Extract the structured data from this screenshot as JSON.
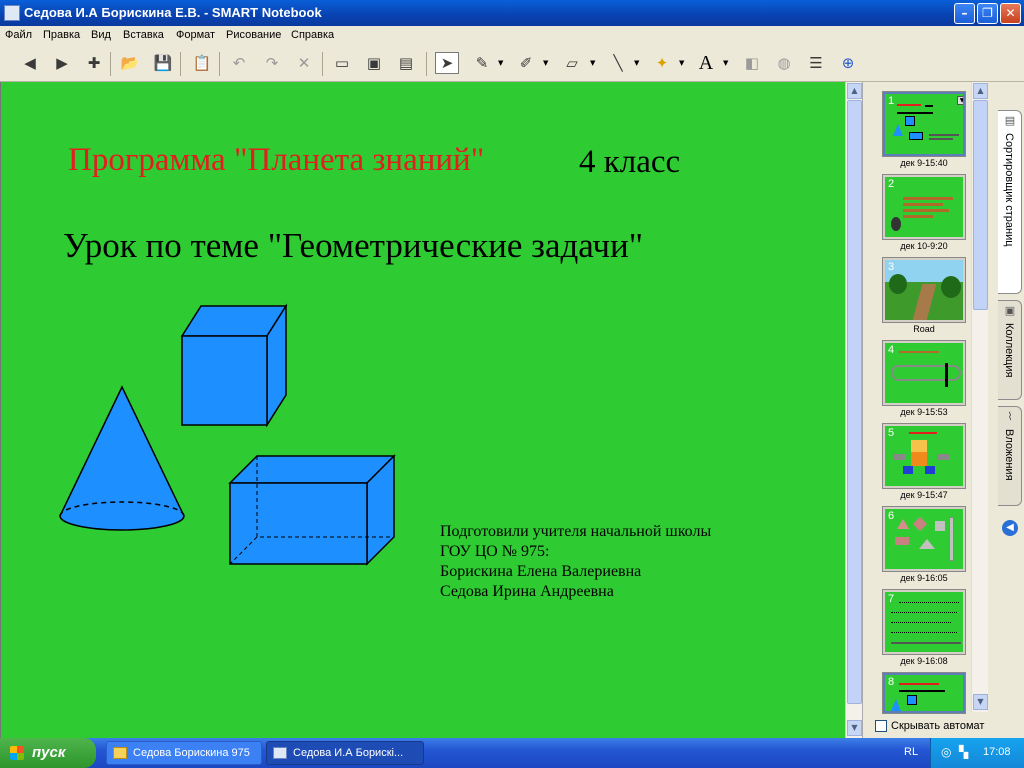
{
  "window": {
    "title": "Седова И.А Борискина Е.В. - SMART Notebook",
    "titlebar_color": "#0a54d0"
  },
  "menu": [
    "Файл",
    "Правка",
    "Вид",
    "Вставка",
    "Формат",
    "Рисование",
    "Справка"
  ],
  "toolbar": {
    "icons": [
      "back-icon",
      "forward-icon",
      "add-page-icon",
      "open-icon",
      "save-icon",
      "paste-icon",
      "undo-icon",
      "redo-icon",
      "delete-icon",
      "screen-shade-icon",
      "full-screen-icon",
      "capture-icon",
      "select-icon",
      "pen-icon",
      "creative-pen-icon",
      "eraser-icon",
      "line-icon",
      "magic-pen-icon",
      "text-icon",
      "fill-icon",
      "properties-icon",
      "more-icon"
    ],
    "text_tool_glyph": "A"
  },
  "slide": {
    "background": "#2ecc32",
    "program": "Программа \"Планета знаний\"",
    "grade": "4 класс",
    "lesson": "Урок по теме \"Геометрические задачи\"",
    "credits": [
      "Подготовили учителя начальной школы",
      "ГОУ ЦО № 975:",
      "Борискина Елена Валериевна",
      "Седова Ирина Андреевна"
    ],
    "shape_color": "#1e8fff",
    "program_color": "#e31e1e"
  },
  "sorter": {
    "thumbnails": [
      {
        "num": "1",
        "label": "дек 9-15:40"
      },
      {
        "num": "2",
        "label": "дек 10-9:20"
      },
      {
        "num": "3",
        "label": "Road"
      },
      {
        "num": "4",
        "label": "дек 9-15:53"
      },
      {
        "num": "5",
        "label": "дек 9-15:47"
      },
      {
        "num": "6",
        "label": "дек 9-16:05"
      },
      {
        "num": "7",
        "label": "дек 9-16:08"
      },
      {
        "num": "8",
        "label": ""
      }
    ],
    "autohide_label": "Скрывать автомат"
  },
  "side_tabs": [
    "Сортировщик страниц",
    "Коллекция",
    "Вложения"
  ],
  "taskbar": {
    "start_label": "пуск",
    "tasks": [
      "Седова Борискина 975",
      "Седова И.А Борискі..."
    ],
    "lang": "RL",
    "clock": "17:08"
  }
}
